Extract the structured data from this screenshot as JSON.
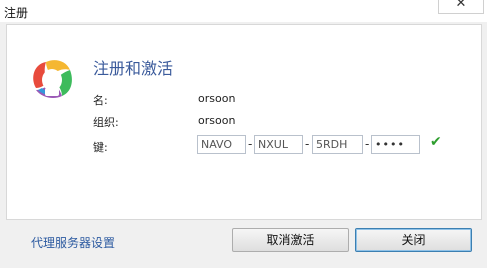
{
  "window": {
    "title": "注册"
  },
  "dialog": {
    "heading": "注册和激活",
    "fields": {
      "name_label": "名:",
      "name_value": "orsoon",
      "org_label": "组织:",
      "org_value": "orsoon",
      "key_label": "键:"
    },
    "key": {
      "part1": "NAVO",
      "part2": "NXUL",
      "part3": "5RDH",
      "part4": "••••",
      "separator": "-"
    },
    "status_icon": "check-icon",
    "status_color": "#2e9e2e"
  },
  "footer": {
    "proxy_link": "代理服务器设置",
    "cancel_activation_button": "取消激活",
    "close_button": "关闭"
  }
}
